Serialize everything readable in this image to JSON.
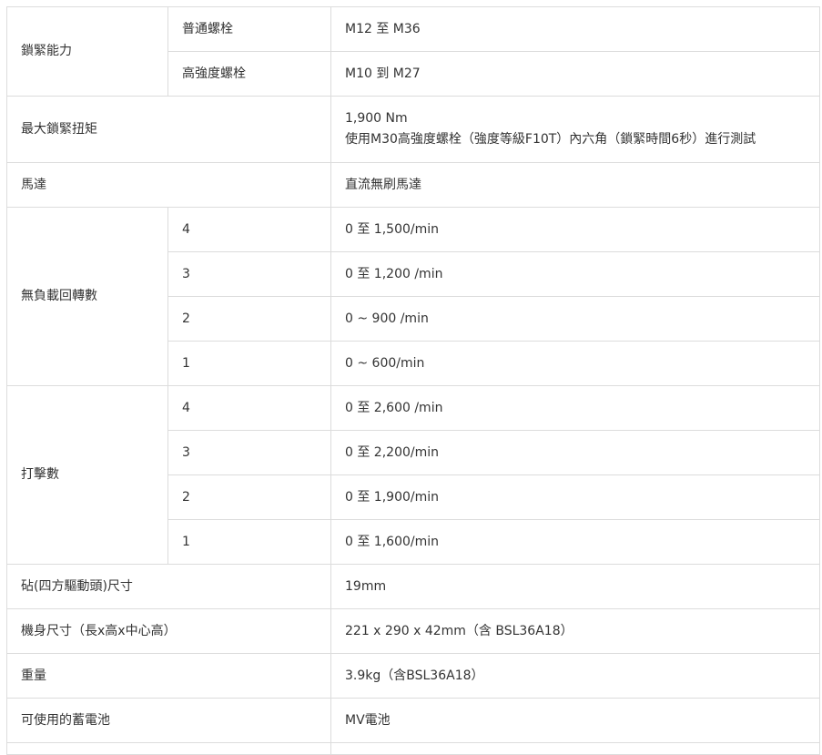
{
  "spec_table": {
    "lock_capacity": {
      "label": "鎖緊能力",
      "normal_bolt": {
        "label": "普通螺栓",
        "value": "M12 至 M36"
      },
      "high_strength_bolt": {
        "label": "高強度螺栓",
        "value": "M10 到 M27"
      }
    },
    "max_torque": {
      "label": "最大鎖緊扭矩",
      "value_line1": "1,900 Nm",
      "value_line2": "使用M30高強度螺栓（強度等級F10T）內六角（鎖緊時間6秒）進行測試"
    },
    "motor": {
      "label": "馬達",
      "value": "直流無刷馬達"
    },
    "no_load_speed": {
      "label": "無負載回轉數",
      "rows": [
        {
          "mode": "4",
          "value": "0 至 1,500/min"
        },
        {
          "mode": "3",
          "value": "0 至 1,200 /min"
        },
        {
          "mode": "2",
          "value": "0 ~ 900 /min"
        },
        {
          "mode": "1",
          "value": "0 ~ 600/min"
        }
      ]
    },
    "impacts": {
      "label": "打擊數",
      "rows": [
        {
          "mode": "4",
          "value": "0 至 2,600 /min"
        },
        {
          "mode": "3",
          "value": "0 至 2,200/min"
        },
        {
          "mode": "2",
          "value": "0 至 1,900/min"
        },
        {
          "mode": "1",
          "value": "0 至 1,600/min"
        }
      ]
    },
    "anvil_size": {
      "label": "砧(四方驅動頭)尺寸",
      "value": "19mm"
    },
    "body_size": {
      "label": "機身尺寸（長x高x中心高）",
      "value": "221 x 290 x 42mm（含 BSL36A18）"
    },
    "weight": {
      "label": "重量",
      "value": "3.9kg（含BSL36A18）"
    },
    "battery": {
      "label": "可使用的蓄電池",
      "value": "MV電池"
    }
  }
}
